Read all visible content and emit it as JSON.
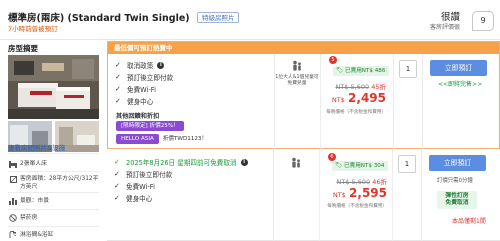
{
  "header": {
    "room_title": "標準房(兩床) (Standard Twin Single)",
    "photos_tag": "特級房照片",
    "recent": "7小時前曾被預訂",
    "rating_word": "很讚",
    "rating_sub": "客房評價很",
    "score": "9"
  },
  "left": {
    "summary_title": "房型摘要",
    "view_photos": "查看房間照片&設施",
    "features": [
      {
        "icon": "single-bed-icon",
        "text": "2張單人床"
      },
      {
        "icon": "room-size-icon",
        "text": "客房面積：28平方公尺/312平方英尺"
      },
      {
        "icon": "city-view-icon",
        "text": "景觀：市景"
      },
      {
        "icon": "no-smoking-icon",
        "text": "禁菸房"
      },
      {
        "icon": "shower-icon",
        "text": "淋浴間&浴缸"
      }
    ]
  },
  "offers": [
    {
      "banner": "最低價可預訂熱賣中",
      "conditions": [
        "取消政策",
        "預訂後立即付款",
        "免費Wi-Fi",
        "健身中心"
      ],
      "promo_title": "其他回饋和折扣",
      "promo_tags": [
        "[限時限定] 折價25%！",
        "HELLO ASIA"
      ],
      "promo_code": "折價TWD1123！",
      "people_text": "1位大人&1個兒童可免費兒童",
      "people_text_green": "免費兒童",
      "saved": "已賣用NT$ 486",
      "discount_count": "5",
      "old_price": "NT$ 5,600",
      "off_pct": "45折",
      "currency": "NT$",
      "new_price": "2,495",
      "price_note": "每晚價格（不含稅金和費用）",
      "qty": "1",
      "book_label": "立即預訂",
      "only_left": "<<即將完售>>"
    },
    {
      "conditions": [
        "2025年8月26日 星期四前可免費取消",
        "預訂後立即付款",
        "免費Wi-Fi",
        "健身中心"
      ],
      "saved": "已賣用NT$ 304",
      "discount_count": "6",
      "old_price": "NT$ 5,600",
      "off_pct": "46折",
      "currency": "NT$",
      "new_price": "2,595",
      "price_note": "每晚價格（不含稅金和費用）",
      "qty": "1",
      "book_label": "立即預訂",
      "small_note": "訂價只需0分鐘",
      "flex_badge_1": "彈性訂房",
      "flex_badge_2": "免費取消",
      "scarce": "本品僅剩1間"
    }
  ],
  "colors": {
    "accent_orange": "#f7a24b",
    "book_button": "#5b8de0",
    "price_red": "#e0352b",
    "green": "#1a9b3c"
  }
}
